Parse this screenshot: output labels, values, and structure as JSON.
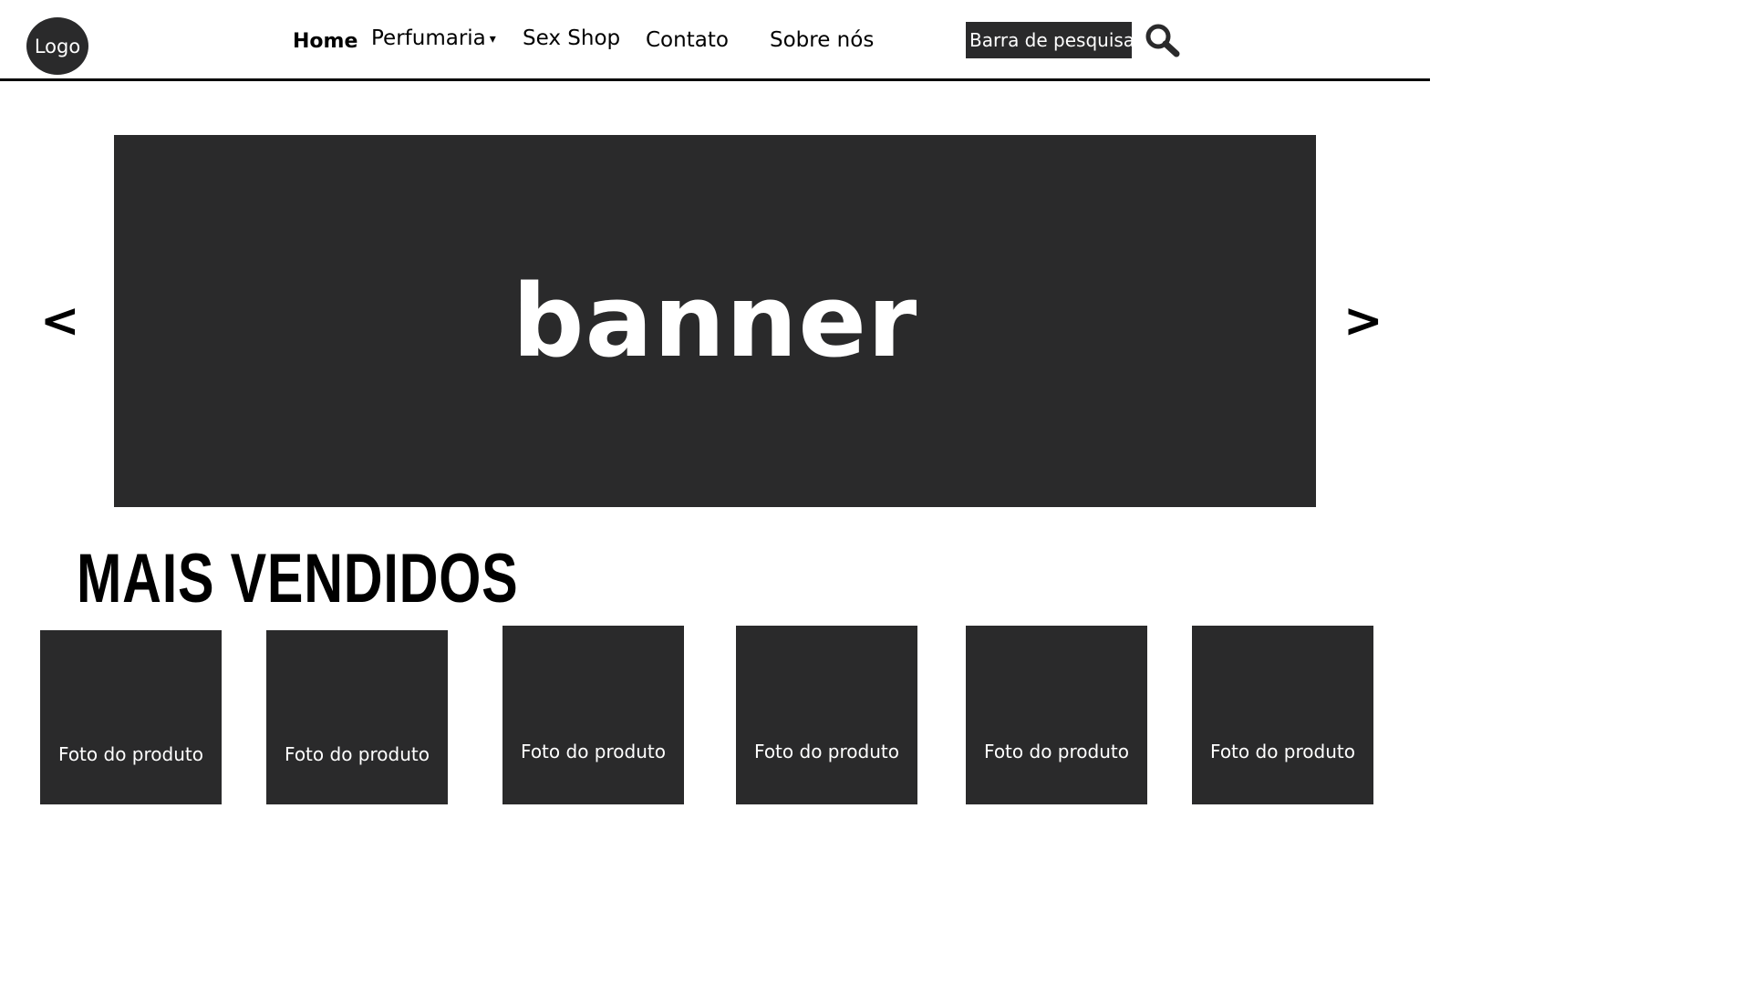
{
  "header": {
    "logo_label": "Logo",
    "nav": {
      "home": "Home",
      "perfumaria": "Perfumaria",
      "perfumaria_caret": "▾",
      "sexshop": "Sex Shop",
      "contato": "Contato",
      "sobre": "Sobre nós"
    },
    "search": {
      "placeholder": "Barra de pesquisa",
      "icon": "search-icon"
    }
  },
  "carousel": {
    "banner_text": "banner",
    "prev_label": "<",
    "next_label": ">"
  },
  "best_sellers": {
    "title": "MAIS VENDIDOS",
    "products": [
      {
        "label": "Foto do produto"
      },
      {
        "label": "Foto do produto"
      },
      {
        "label": "Foto do produto"
      },
      {
        "label": "Foto do produto"
      },
      {
        "label": "Foto do produto"
      },
      {
        "label": "Foto do produto"
      }
    ]
  },
  "colors": {
    "dark_block": "#2a2a2b",
    "background": "#ffffff",
    "text": "#000000"
  }
}
